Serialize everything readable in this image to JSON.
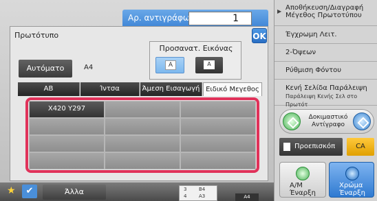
{
  "copies": {
    "label": "Αρ. αντιγράφων",
    "value": "1"
  },
  "dialog": {
    "title": "Πρωτότυπο",
    "ok": "OK",
    "orientation_title": "Προσανατ. Εικόνας",
    "orientation_a": "A",
    "orientation_b": "A",
    "auto_button": "Αυτόματο",
    "auto_size": "A4",
    "tabs": [
      "AB",
      "Ίντσα",
      "Άμεση Εισαγωγή",
      "Ειδικό Μεγεθος"
    ],
    "active_tab": "Ειδικό Μεγεθος",
    "grid": [
      [
        "X420 Y297",
        "",
        ""
      ],
      [
        "",
        "",
        ""
      ],
      [
        "",
        "",
        ""
      ],
      [
        "",
        "",
        ""
      ]
    ]
  },
  "bottom_bar": {
    "other": "Άλλα",
    "tray_rows": [
      {
        "num": "3",
        "size": "B4"
      },
      {
        "num": "4",
        "size": "A3"
      }
    ],
    "tray_current": "A4"
  },
  "side_menu": {
    "items": [
      {
        "label": "Αποθήκευση/Διαγραφή Μέγεθος Πρωτοτύπου"
      },
      {
        "label": "Έγχρωμη Λειτ."
      },
      {
        "label": "2-Όψεων"
      },
      {
        "label": "Ρύθμιση Φόντου"
      },
      {
        "label": "Κενή Σελίδα Παράλειψη",
        "sub": "Παράλειψη Κενής Σελ στο Πρωτότ"
      }
    ],
    "test_copy": "Δοκιμαστικό Αντίγραφο",
    "preview": "Προεπισκόπ",
    "ca": "CA",
    "start_bw": {
      "line1": "A/M",
      "line2": "Έναρξη"
    },
    "start_color": {
      "line1": "Χρώμα",
      "line2": "Έναρξη"
    }
  }
}
